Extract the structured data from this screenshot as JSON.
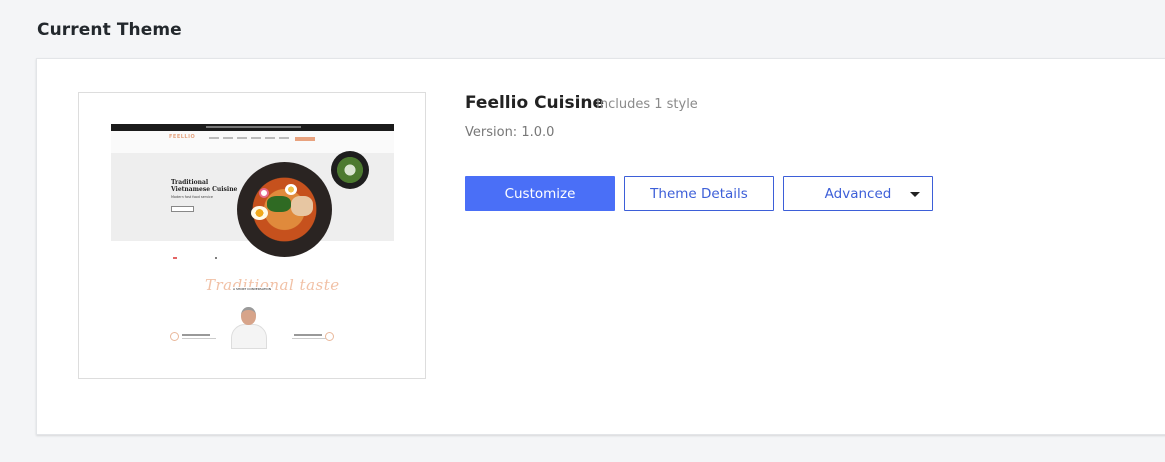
{
  "section": {
    "title": "Current Theme"
  },
  "theme": {
    "name": "Feellio Cuisine",
    "styles": "Includes 1 style",
    "version": "Version: 1.0.0"
  },
  "preview": {
    "logo": "FEELLIO",
    "headline": "Traditional Vietnamese Cuisine",
    "subline": "Modern fast food service",
    "script_text": "Traditional taste",
    "tagline": "A SHORT CONVERSATION"
  },
  "actions": {
    "customize": "Customize",
    "details": "Theme Details",
    "advanced": "Advanced"
  },
  "colors": {
    "primary": "#4a6ff7",
    "outline": "#3d5fd8",
    "accent_preview": "#e8a27e"
  }
}
